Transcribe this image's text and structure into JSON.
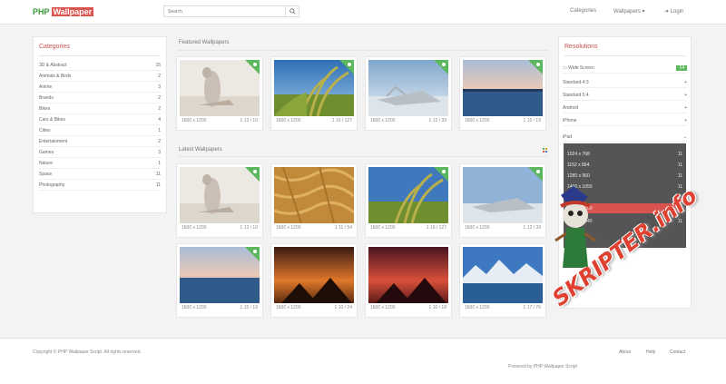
{
  "header": {
    "logo_left": "PHP",
    "logo_right": "Wallpaper",
    "search_placeholder": "Search",
    "nav": [
      "Categories",
      "Wallpapers",
      "Login"
    ]
  },
  "categories": {
    "title": "Categories",
    "items": [
      {
        "label": "3D & Abstract",
        "count": "15"
      },
      {
        "label": "Animals & Birds",
        "count": "2"
      },
      {
        "label": "Anime",
        "count": "3"
      },
      {
        "label": "Brands",
        "count": "2"
      },
      {
        "label": "Bikes",
        "count": "2"
      },
      {
        "label": "Cars & Bikes",
        "count": "4"
      },
      {
        "label": "Cities",
        "count": "1"
      },
      {
        "label": "Entertainment",
        "count": "2"
      },
      {
        "label": "Games",
        "count": "3"
      },
      {
        "label": "Nature",
        "count": "1"
      },
      {
        "label": "Space",
        "count": "11"
      },
      {
        "label": "Photography",
        "count": "11"
      }
    ]
  },
  "featured": {
    "title": "Featured Wallpapers",
    "cards": [
      {
        "res": "1600 x 1200",
        "stats": "1 13 / 10"
      },
      {
        "res": "1600 x 1200",
        "stats": "1 19 / 127"
      },
      {
        "res": "1600 x 1200",
        "stats": "1 12 / 39"
      },
      {
        "res": "1600 x 1200",
        "stats": "1 15 / 19"
      }
    ]
  },
  "latest": {
    "title": "Latest Wallpapers",
    "cards": [
      {
        "res": "1600 x 1200",
        "stats": "1 13 / 10"
      },
      {
        "res": "1600 x 1200",
        "stats": "1 11 / 54"
      },
      {
        "res": "1600 x 1200",
        "stats": "1 19 / 127"
      },
      {
        "res": "1600 x 1200",
        "stats": "1 12 / 39"
      },
      {
        "res": "1600 x 1200",
        "stats": "1 15 / 19"
      },
      {
        "res": "1600 x 1200",
        "stats": "1 10 / 24"
      },
      {
        "res": "1600 x 1200",
        "stats": "1 10 / 18"
      },
      {
        "res": "1600 x 1200",
        "stats": "1 17 / 76"
      }
    ]
  },
  "sidebar": {
    "title": "Resolutions",
    "items": [
      {
        "label": "Wide Screen",
        "count": "14"
      },
      {
        "label": "Standard 4:3",
        "count": "+"
      },
      {
        "label": "Standard 5:4",
        "count": "+"
      },
      {
        "label": "Android",
        "count": "+"
      },
      {
        "label": "iPhone",
        "count": "+"
      },
      {
        "label": "iPad",
        "count": "+"
      }
    ],
    "dropdown": [
      {
        "label": "1024 x 768",
        "count": "11"
      },
      {
        "label": "1152 x 864",
        "count": "11"
      },
      {
        "label": "1280 x 960",
        "count": "11"
      },
      {
        "label": "1400 x 1050",
        "count": "11"
      },
      {
        "label": "1600 x 1200",
        "count": "11"
      },
      {
        "label": "1920 x 1440",
        "count": "11"
      }
    ],
    "dropdown_active_index": 4
  },
  "footer": {
    "left_text": "Copyright © PHP Wallpaper Script. All rights reserved.",
    "links": [
      "About",
      "Help",
      "Contact"
    ],
    "credit": "Powered by PHP Wallpaper Script"
  },
  "watermark": "SKRIPTER.info",
  "colors": {
    "accent": "#d9534f",
    "ribbon": "#5cb85c",
    "dropdown_bg": "#555555"
  }
}
